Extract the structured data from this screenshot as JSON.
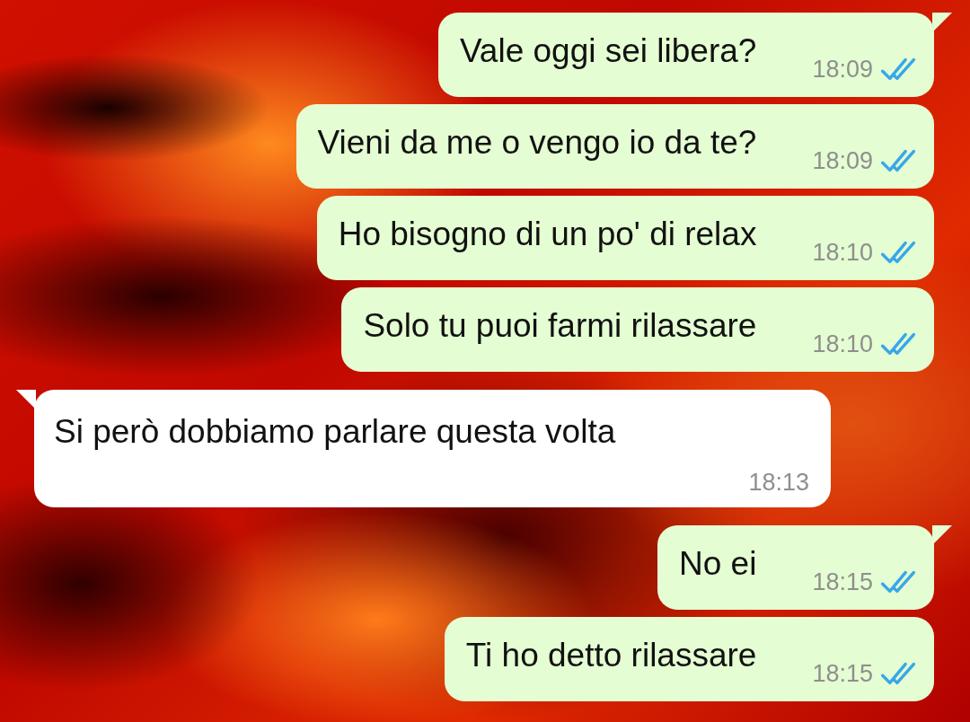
{
  "messages": [
    {
      "kind": "outgoing",
      "text": "Vale oggi sei libera?",
      "time": "18:09",
      "read": true,
      "tail": true
    },
    {
      "kind": "outgoing",
      "text": "Vieni da me o vengo io da te?",
      "time": "18:09",
      "read": true,
      "tail": false
    },
    {
      "kind": "outgoing",
      "text": "Ho bisogno di un po' di relax",
      "time": "18:10",
      "read": true,
      "tail": false
    },
    {
      "kind": "outgoing",
      "text": "Solo tu puoi farmi rilassare",
      "time": "18:10",
      "read": true,
      "tail": false
    },
    {
      "kind": "incoming",
      "text": "Si però dobbiamo parlare questa volta",
      "time": "18:13",
      "tail": true
    },
    {
      "kind": "outgoing",
      "text": "No ei",
      "time": "18:15",
      "read": true,
      "tail": true
    },
    {
      "kind": "outgoing",
      "text": "Ti ho detto rilassare",
      "time": "18:15",
      "read": true,
      "tail": false
    }
  ]
}
